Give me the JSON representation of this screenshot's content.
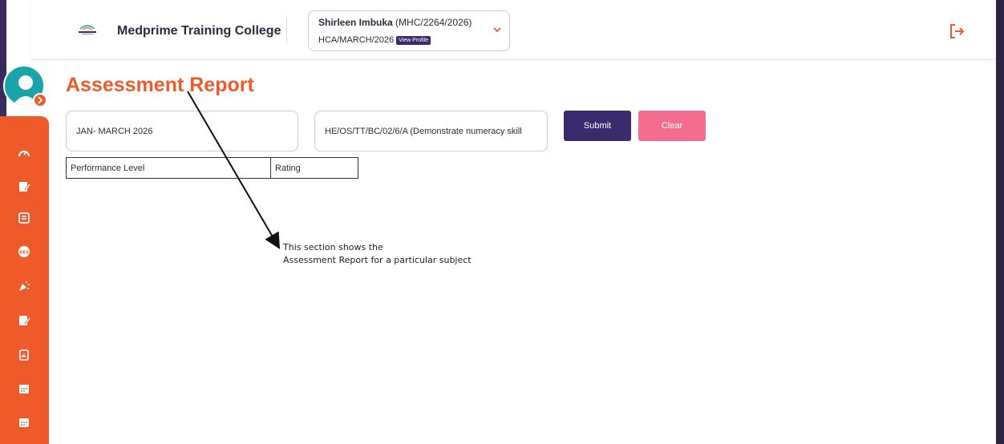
{
  "header": {
    "college_name": "Medprime Training College",
    "student_name": "Shirleen Imbuka",
    "student_reg": "(MHC/2264/2026)",
    "student_class": "HCA/MARCH/2026",
    "view_profile_label": "View Profile"
  },
  "sidebar": {
    "items": [
      {
        "icon": "dashboard-icon"
      },
      {
        "icon": "edit-note-icon"
      },
      {
        "icon": "document-icon"
      },
      {
        "icon": "kes-fees-icon"
      },
      {
        "icon": "celebration-icon"
      },
      {
        "icon": "edit-note-icon"
      },
      {
        "icon": "report-icon"
      },
      {
        "icon": "calendar-icon"
      },
      {
        "icon": "calendar-icon"
      }
    ]
  },
  "main": {
    "title": "Assessment Report",
    "term_value": "JAN- MARCH 2026",
    "unit_value": "HE/OS/TT/BC/02/6/A (Demonstrate numeracy skill",
    "submit_label": "Submit",
    "clear_label": "Clear",
    "table_headers": [
      "Performance Level",
      "Rating"
    ]
  },
  "annotation": {
    "line1": "This section shows the",
    "line2": "Assessment Report for a particular subject"
  },
  "colors": {
    "accent_orange": "#ee5a2a",
    "primary_purple": "#3b2a6e",
    "clear_pink": "#f26d8f",
    "avatar_teal": "#1aa3a9"
  }
}
